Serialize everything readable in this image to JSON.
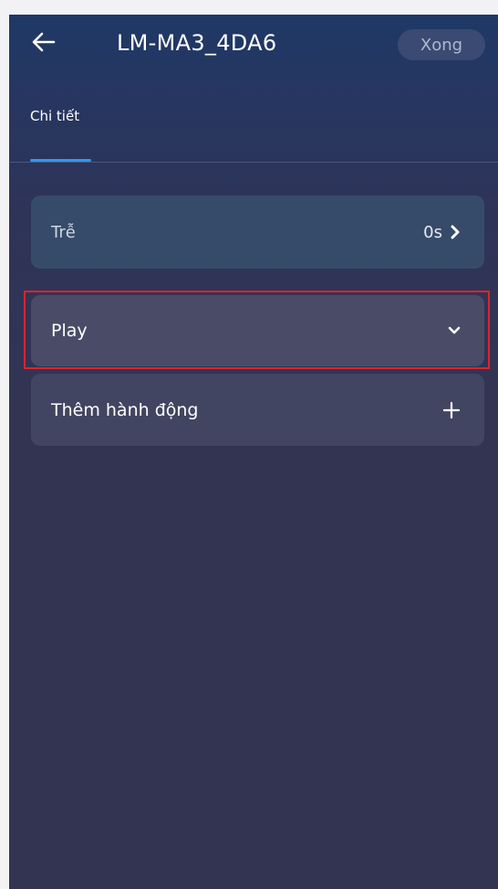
{
  "header": {
    "title": "LM-MA3_4DA6",
    "done_label": "Xong",
    "back_icon": "arrow-left-icon"
  },
  "tabs": [
    {
      "label": "Chi tiết",
      "active": true
    }
  ],
  "colors": {
    "accent": "#2f95f5",
    "highlight": "#e0222c",
    "background": "#323452"
  },
  "items": {
    "delay": {
      "label": "Trễ",
      "value": "0s",
      "icon": "chevron-right-icon"
    },
    "play": {
      "label": "Play",
      "icon": "chevron-down-icon"
    },
    "add_action": {
      "label": "Thêm hành động",
      "icon": "plus-icon"
    }
  }
}
